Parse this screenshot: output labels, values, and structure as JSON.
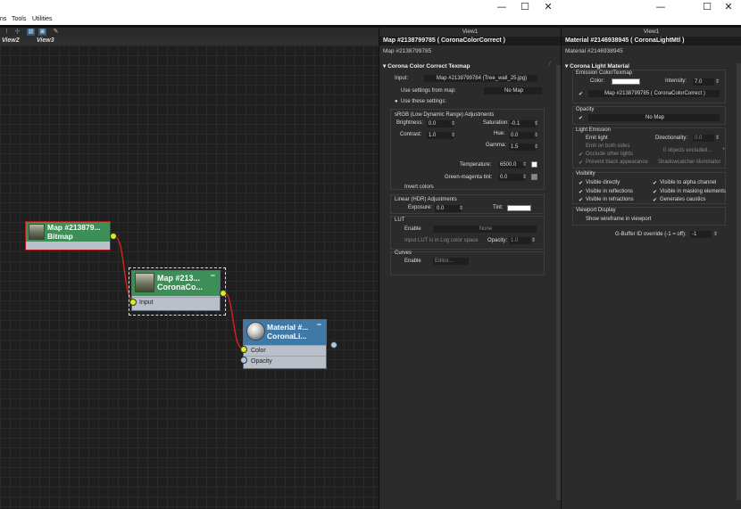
{
  "window": {
    "minimize": "—",
    "maximize": "☐",
    "close": "✕"
  },
  "menu": {
    "item1": "ns",
    "item2": "Tools",
    "item3": "Utilities"
  },
  "views": {
    "tab1": "View2",
    "tab2": "View3"
  },
  "nodes": {
    "bitmap": {
      "title": "Map #213879...",
      "subtitle": "Bitmap"
    },
    "colorcorrect": {
      "title": "Map #213...",
      "subtitle": "CoronaCo...",
      "port": "Input"
    },
    "material": {
      "title": "Material #...",
      "subtitle": "CoronaLi...",
      "port1": "Color",
      "port2": "Opacity"
    }
  },
  "panel1": {
    "view": "View1",
    "title": "Map #2138799785  ( CoronaColorCorrect )",
    "name": "Map #2138799785",
    "section": "Corona Color Correct Texmap",
    "input_label": "Input:",
    "input_value": "Map #2138799784 (Tree_wall_25.jpg)",
    "use_map": "Use settings from map:",
    "no_map": "No Map",
    "use_these": "Use these settings:",
    "srgb": "sRGB (Low Dynamic Range) Adjustments",
    "brightness_l": "Brightness:",
    "brightness_v": "0.0",
    "saturation_l": "Saturation:",
    "saturation_v": "-0.1",
    "hue_l": "Hue:",
    "hue_v": "0.0",
    "contrast_l": "Contrast:",
    "contrast_v": "1.0",
    "gamma_l": "Gamma:",
    "gamma_v": "1.5",
    "temp_l": "Temperature:",
    "temp_v": "6500.0",
    "gm_l": "Green-magenta tint:",
    "gm_v": "0.0",
    "invert": "Invert colors",
    "linear": "Linear (HDR) Adjustments",
    "exposure_l": "Exposure:",
    "exposure_v": "0.0",
    "tint_l": "Tint:",
    "lut": "LUT",
    "lut_enable": "Enable",
    "lut_none": "None",
    "lut_log": "Input LUT is in Log color space",
    "opacity_l": "Opacity:",
    "opacity_v": "1.0",
    "curves": "Curves",
    "curves_enable": "Enable",
    "editor": "Editor..."
  },
  "panel2": {
    "view": "View1",
    "title": "Material #2146938945  ( CoronaLightMtl )",
    "name": "Material #2146938945",
    "section": "Corona Light Material",
    "emission": "Emission Color/Texmap",
    "color_l": "Color:",
    "intensity_l": "Intensity:",
    "intensity_v": "7.0",
    "tex_btn": "Map #2138799785 ( CoronaColorCorrect )",
    "opacity": "Opacity",
    "no_map": "No Map",
    "light_emission": "Light Emission",
    "emit_light": "Emit light",
    "directionality_l": "Directionality:",
    "directionality_v": "0.0",
    "emit_both": "Emit on both sides",
    "occlude": "Occlude other lights",
    "excluded": "0 objects excluded...",
    "prevent": "Prevent black appearance",
    "shadowcatcher": "Shadowcatcher illuminator",
    "visibility": "Visibility",
    "vis_directly": "Visible directly",
    "vis_alpha": "Visible to alpha channel",
    "vis_refl": "Visible in reflections",
    "vis_mask": "Visible in masking elements",
    "vis_refr": "Visible in refractions",
    "caustics": "Generates caustics",
    "viewport": "Viewport Display",
    "wireframe": "Show wireframe in viewport",
    "gbuffer_l": "G-Buffer ID override (-1 = off):",
    "gbuffer_v": "-1"
  }
}
